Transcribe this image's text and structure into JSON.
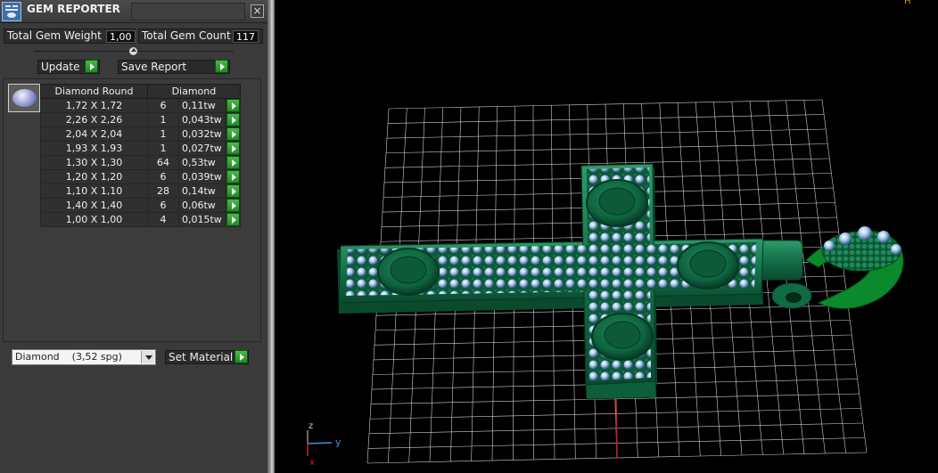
{
  "window": {
    "title": "GEM REPORTER",
    "close_label": "×"
  },
  "stats": {
    "total_weight_label": "Total Gem Weight",
    "total_weight_value": "1,00",
    "total_count_label": "Total Gem Count",
    "total_count_value": "117"
  },
  "actions": {
    "update_label": "Update",
    "save_report_label": "Save Report"
  },
  "gem_table": {
    "headers": [
      "Diamond Round",
      "Diamond"
    ],
    "rows": [
      {
        "size": "1,72 X 1,72",
        "count": "6",
        "weight": "0,11tw"
      },
      {
        "size": "2,26 X 2,26",
        "count": "1",
        "weight": "0,043tw"
      },
      {
        "size": "2,04 X 2,04",
        "count": "1",
        "weight": "0,032tw"
      },
      {
        "size": "1,93 X 1,93",
        "count": "1",
        "weight": "0,027tw"
      },
      {
        "size": "1,30 X 1,30",
        "count": "64",
        "weight": "0,53tw"
      },
      {
        "size": "1,20 X 1,20",
        "count": "6",
        "weight": "0,039tw"
      },
      {
        "size": "1,10 X 1,10",
        "count": "28",
        "weight": "0,14tw"
      },
      {
        "size": "1,40 X 1,40",
        "count": "6",
        "weight": "0,06tw"
      },
      {
        "size": "1,00 X 1,00",
        "count": "4",
        "weight": "0,015tw"
      }
    ]
  },
  "material": {
    "selected": "Diamond    (3,52 spg)",
    "set_label": "Set Material"
  },
  "viewport": {
    "axis_z": "z",
    "axis_y": "y",
    "axis_x": "x",
    "corner_mark": "H",
    "colors": {
      "background": "#000000",
      "grid": "#cfcfcf",
      "metal": "#0f6b45",
      "gem": "#9fc4e8",
      "x_axis": "#d02020",
      "y_axis": "#4a8fe0",
      "z_axis": "#cfcfcf"
    }
  }
}
